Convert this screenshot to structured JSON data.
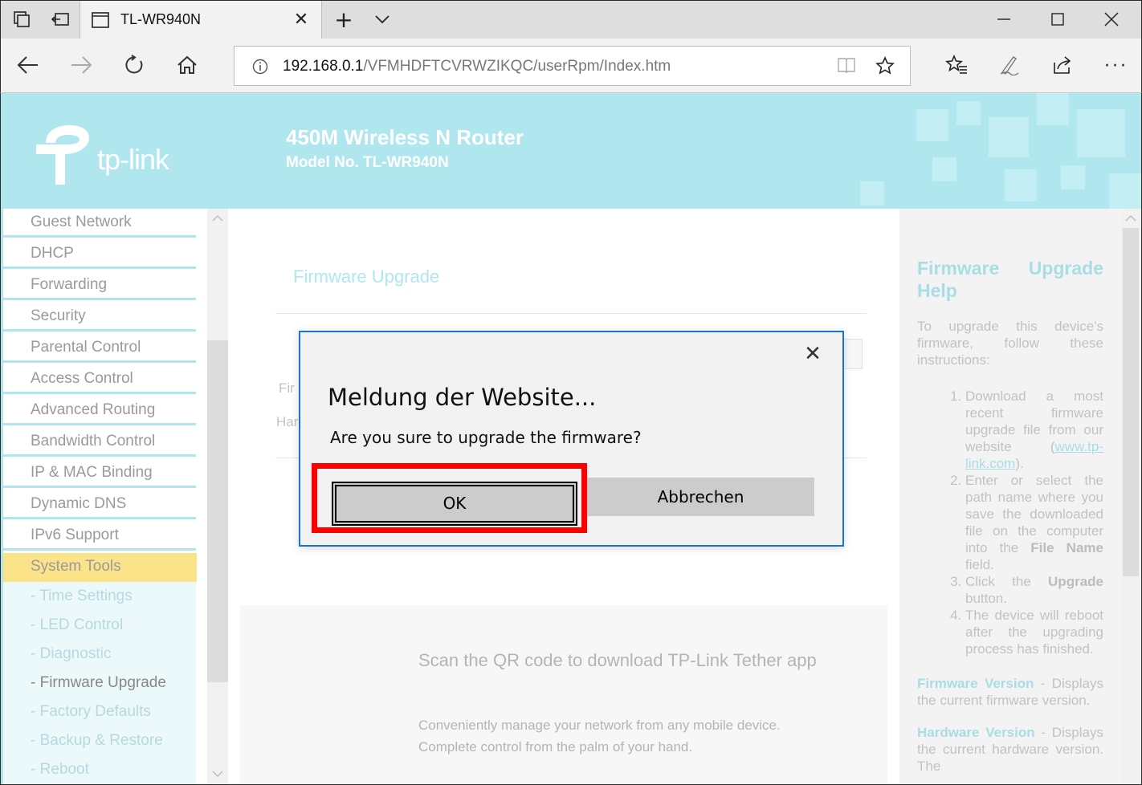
{
  "browser": {
    "tab_title": "TL-WR940N",
    "url_host": "192.168.0.1",
    "url_path": "/VFMHDFTCVRWZIKQC/userRpm/Index.htm"
  },
  "header": {
    "logo_text": "tp-link",
    "router_name": "450M Wireless N Router",
    "model_no": "Model No. TL-WR940N"
  },
  "sidebar": {
    "items": [
      "Guest Network",
      "DHCP",
      "Forwarding",
      "Security",
      "Parental Control",
      "Access Control",
      "Advanced Routing",
      "Bandwidth Control",
      "IP & MAC Binding",
      "Dynamic DNS",
      "IPv6 Support",
      "System Tools"
    ],
    "sub_items": [
      "- Time Settings",
      "- LED Control",
      "- Diagnostic",
      "- Firmware Upgrade",
      "- Factory Defaults",
      "- Backup & Restore",
      "- Reboot"
    ]
  },
  "main": {
    "title": "Firmware Upgrade",
    "label_partial_1": "Fir",
    "label_partial_2": "Har",
    "qr_title": "Scan the QR code to download TP-Link Tether app",
    "qr_desc_1": "Conveniently manage your network from any mobile device.",
    "qr_desc_2": "Complete control from the palm of your hand."
  },
  "help": {
    "title": "Firmware Upgrade Help",
    "intro": "To upgrade this device's firmware, follow these instructions:",
    "step1_a": "Download a most recent firmware upgrade file from our website (",
    "step1_link": "www.tp-link.com",
    "step1_b": ").",
    "step2_a": "Enter or select the path name where you save the downloaded file on the computer into the ",
    "step2_bold": "File Name",
    "step2_b": " field.",
    "step3_a": "Click the ",
    "step3_bold": "Upgrade",
    "step3_b": " button.",
    "step4": "The device will reboot after the upgrading process has finished.",
    "fw_version_label": "Firmware Version",
    "fw_version_text": " - Displays the current firmware version.",
    "hw_version_label": "Hardware Version",
    "hw_version_text": " - Displays the current hardware version. The"
  },
  "dialog": {
    "title": "Meldung der Website...",
    "message": "Are you sure to upgrade the firmware?",
    "ok_label": "OK",
    "cancel_label": "Abbrechen"
  },
  "colors": {
    "brand": "#b0e7ef",
    "active_menu": "#fbe38a",
    "highlight": "#ff0000",
    "dialog_border": "#1874d0"
  }
}
